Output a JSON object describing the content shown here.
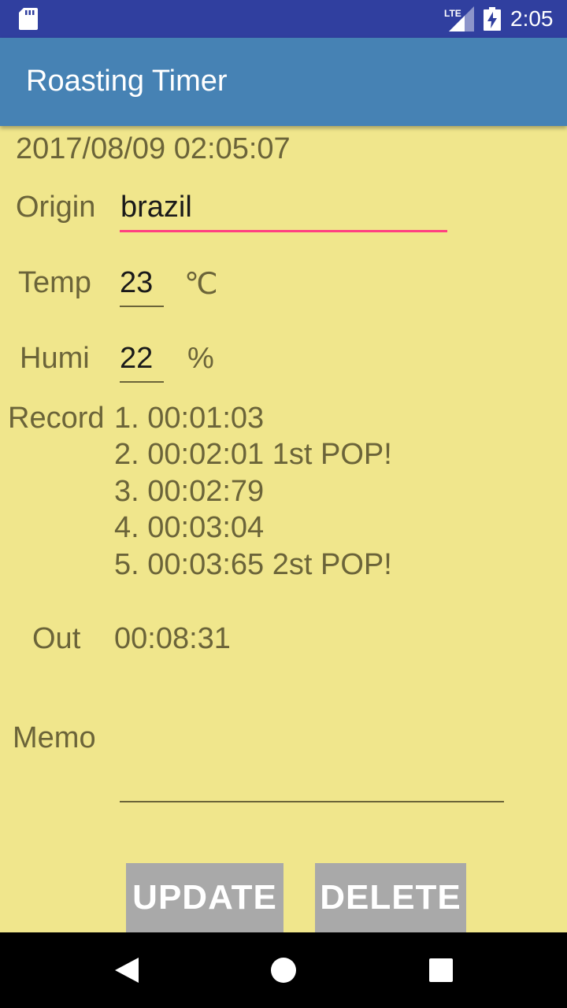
{
  "status_bar": {
    "time": "2:05",
    "network_label": "LTE",
    "icons": [
      "sd-card-icon",
      "lte-signal-icon",
      "battery-charging-icon"
    ]
  },
  "app_bar": {
    "title": "Roasting Timer",
    "color": "#4682b4"
  },
  "timestamp": "2017/08/09 02:05:07",
  "form": {
    "origin": {
      "label": "Origin",
      "value": "brazil"
    },
    "temp": {
      "label": "Temp",
      "value": "23",
      "unit": "℃"
    },
    "humi": {
      "label": "Humi",
      "value": "22",
      "unit": "%"
    }
  },
  "record": {
    "label": "Record",
    "entries": [
      "1. 00:01:03",
      "2. 00:02:01 1st POP!",
      "3. 00:02:79",
      "4. 00:03:04",
      "5. 00:03:65 2st POP!"
    ]
  },
  "out": {
    "label": "Out",
    "value": "00:08:31"
  },
  "memo": {
    "label": "Memo",
    "value": ""
  },
  "buttons": {
    "update": "UPDATE",
    "delete": "DELETE"
  },
  "nav_bar": {
    "icons": [
      "back-icon",
      "home-icon",
      "recents-icon"
    ]
  },
  "colors": {
    "background": "#f0e68c",
    "status_bar": "#303f9f",
    "accent": "#ff4081",
    "button": "#a9a9a9"
  }
}
